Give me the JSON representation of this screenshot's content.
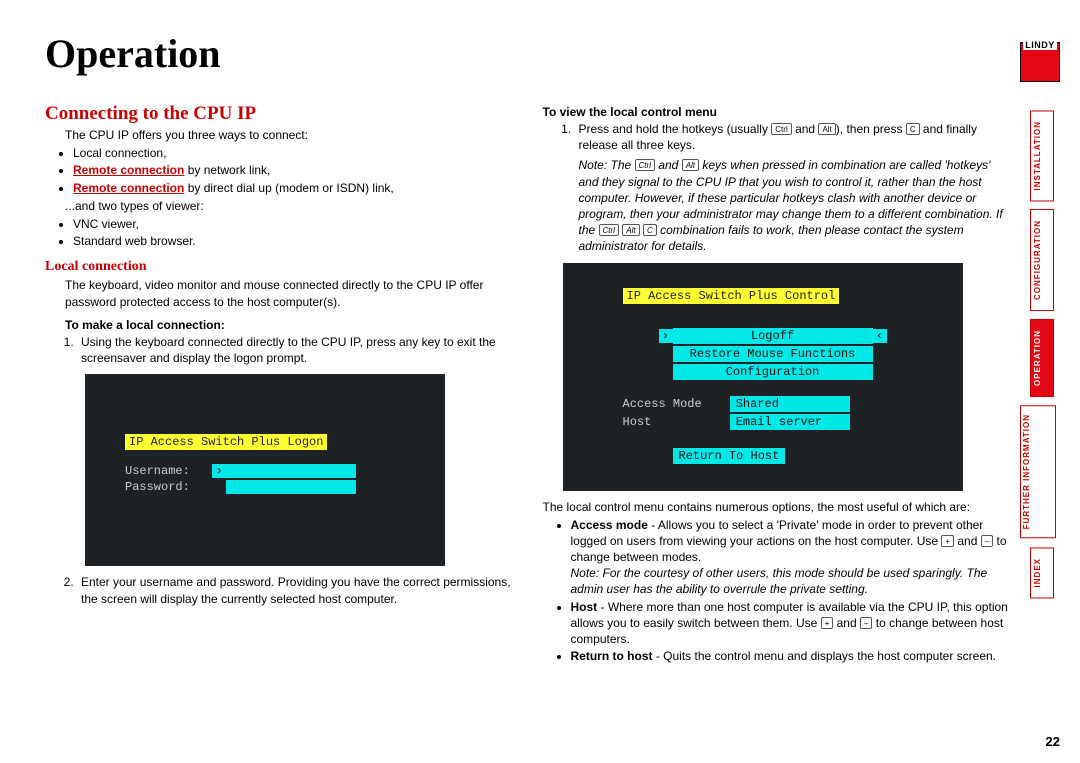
{
  "page": {
    "title": "Operation",
    "number": "22"
  },
  "sec1": {
    "heading": "Connecting to the CPU IP",
    "intro": "The CPU IP offers you three ways to connect:",
    "ways": {
      "local": "Local connection,",
      "remote_link_a": "Remote connection",
      "remote_link_b": " by network link,",
      "remote_dial_a": "Remote connection",
      "remote_dial_b": " by direct dial up (modem or ISDN) link,"
    },
    "viewers_intro": "...and two types of viewer:",
    "viewers": {
      "vnc": "VNC viewer,",
      "browser": "Standard web browser."
    }
  },
  "localconn": {
    "heading": "Local connection",
    "intro": "The keyboard, video monitor and mouse connected directly to the CPU IP offer password protected access to the host computer(s).",
    "make_h": "To make a local connection:",
    "step1": "Using the keyboard connected directly to the CPU IP, press any key to exit the screensaver and display the logon prompt.",
    "step2": "Enter your username and password. Providing you have the correct permissions, the screen will display the currently selected host computer."
  },
  "term1": {
    "title": "IP Access Switch Plus Logon",
    "user": "Username:",
    "pass": "Password:"
  },
  "view_menu": {
    "heading": "To view the local control menu",
    "step1_a": "Press and hold the hotkeys (usually ",
    "step1_b": " and ",
    "step1_c": "), then press ",
    "step1_d": " and finally release all three keys.",
    "note1_a": "Note: The ",
    "note1_b": " and ",
    "note1_c": " keys when pressed in combination are called 'hotkeys' and they signal to the CPU IP that you wish to control it, rather than the host computer. However, if these particular hotkeys clash with another device or program, then your administrator may change them to a different combination. If the ",
    "note1_d": " combination fails to work, then please contact the system administrator for details."
  },
  "keys": {
    "ctrl": "Ctrl",
    "alt": "Alt",
    "c": "C",
    "plus": "+",
    "minus": "–"
  },
  "term2": {
    "title": "IP Access Switch Plus Control",
    "logoff": "Logoff",
    "restore": "Restore Mouse Functions",
    "config": "Configuration",
    "access_mode_l": "Access Mode",
    "access_mode_v": "Shared",
    "host_l": "Host",
    "host_v": "Email server",
    "return": "Return To Host"
  },
  "after_term": {
    "intro": "The local control menu contains numerous options, the most useful of which are:",
    "access_a": "Access mode",
    "access_b": " - Allows you to select a 'Private' mode in order to prevent other logged on users from viewing your actions on the host computer. Use ",
    "access_c": " and ",
    "access_d": " to change between modes.",
    "access_note": "Note: For the courtesy of other users, this mode should be used sparingly. The admin user has the ability to overrule the private setting.",
    "host_a": "Host",
    "host_b": " - Where more than one host computer is available via the CPU IP, this option allows you to easily switch between them. Use ",
    "host_c": " and ",
    "host_d": " to change between host computers.",
    "return_a": "Return to host",
    "return_b": " - Quits the control menu and displays the host computer screen."
  },
  "nav": {
    "brand": "LINDY",
    "tabs": {
      "installation": "INSTALLATION",
      "configuration": "CONFIGURATION",
      "operation": "OPERATION",
      "further": "FURTHER\nINFORMATION",
      "index": "INDEX"
    }
  }
}
